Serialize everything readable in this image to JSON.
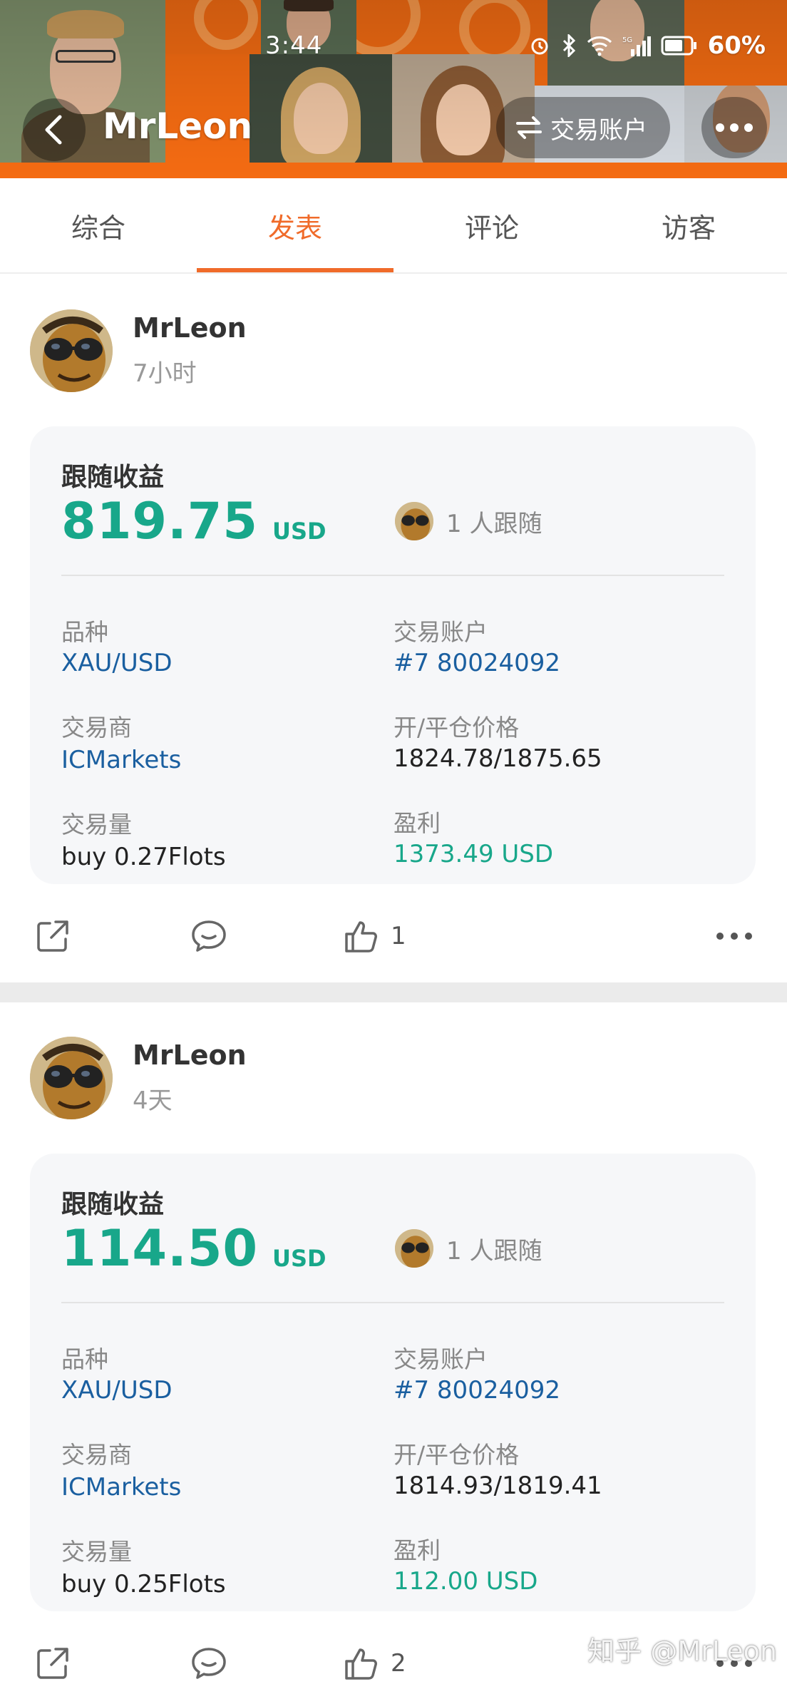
{
  "status_bar": {
    "time": "3:44",
    "battery": "60%",
    "icons": [
      "alarm-icon",
      "bluetooth-icon",
      "wifi-icon",
      "signal-5g-icon",
      "battery-saver-icon"
    ]
  },
  "header": {
    "title": "MrLeon",
    "switch_label": "交易账户",
    "accent": "#f46b12"
  },
  "tabs": [
    {
      "label": "综合",
      "active": false
    },
    {
      "label": "发表",
      "active": true
    },
    {
      "label": "评论",
      "active": false
    },
    {
      "label": "访客",
      "active": false
    }
  ],
  "posts": [
    {
      "author": "MrLeon",
      "time": "7小时",
      "card": {
        "title": "跟随收益",
        "amount": "819.75",
        "unit": "USD",
        "followers": "1 人跟随",
        "symbol_label": "品种",
        "symbol": "XAU/USD",
        "account_label": "交易账户",
        "account": "#7 80024092",
        "broker_label": "交易商",
        "broker": "ICMarkets",
        "price_label": "开/平仓价格",
        "price": "1824.78/1875.65",
        "volume_label": "交易量",
        "volume": "buy 0.27Flots",
        "profit_label": "盈利",
        "profit": "1373.49 USD"
      },
      "likes": "1"
    },
    {
      "author": "MrLeon",
      "time": "4天",
      "card": {
        "title": "跟随收益",
        "amount": "114.50",
        "unit": "USD",
        "followers": "1 人跟随",
        "symbol_label": "品种",
        "symbol": "XAU/USD",
        "account_label": "交易账户",
        "account": "#7 80024092",
        "broker_label": "交易商",
        "broker": "ICMarkets",
        "price_label": "开/平仓价格",
        "price": "1814.93/1819.41",
        "volume_label": "交易量",
        "volume": "buy 0.25Flots",
        "profit_label": "盈利",
        "profit": "112.00 USD"
      },
      "likes": "2"
    }
  ],
  "watermark": "知乎 @MrLeon",
  "colors": {
    "profit_green": "#18a78a",
    "link_blue": "#1a5fa0",
    "tab_active": "#f06b2a"
  }
}
